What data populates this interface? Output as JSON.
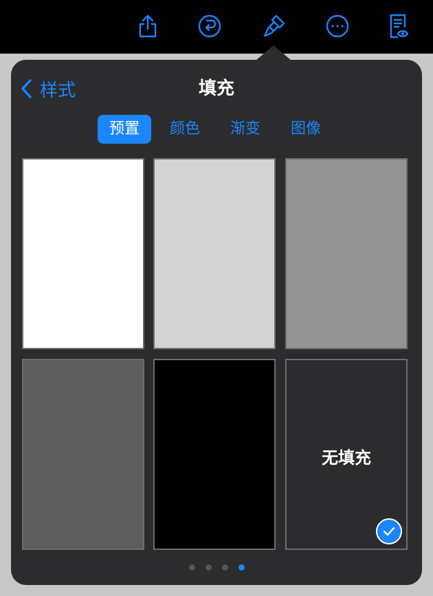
{
  "toolbar": {
    "buttons": [
      {
        "icon": "share-icon"
      },
      {
        "icon": "undo-icon"
      },
      {
        "icon": "paintbrush-icon"
      },
      {
        "icon": "more-icon"
      },
      {
        "icon": "document-preview-icon"
      }
    ]
  },
  "popover": {
    "back_label": "样式",
    "title": "填充",
    "tabs": [
      {
        "label": "预置",
        "active": true
      },
      {
        "label": "颜色",
        "active": false
      },
      {
        "label": "渐变",
        "active": false
      },
      {
        "label": "图像",
        "active": false
      }
    ],
    "swatches": [
      {
        "color": "#ffffff"
      },
      {
        "color": "#d4d4d4"
      },
      {
        "color": "#939393"
      },
      {
        "color": "#5e5e5e"
      },
      {
        "color": "#000000"
      },
      {
        "color": "#2c2c2e",
        "label": "无填充",
        "selected": true
      }
    ],
    "page_dots": {
      "count": 4,
      "active": 4
    }
  },
  "colors": {
    "accent": "#1a86ff",
    "popover_bg": "#2c2c2e",
    "toolbar_bg": "#000000"
  }
}
